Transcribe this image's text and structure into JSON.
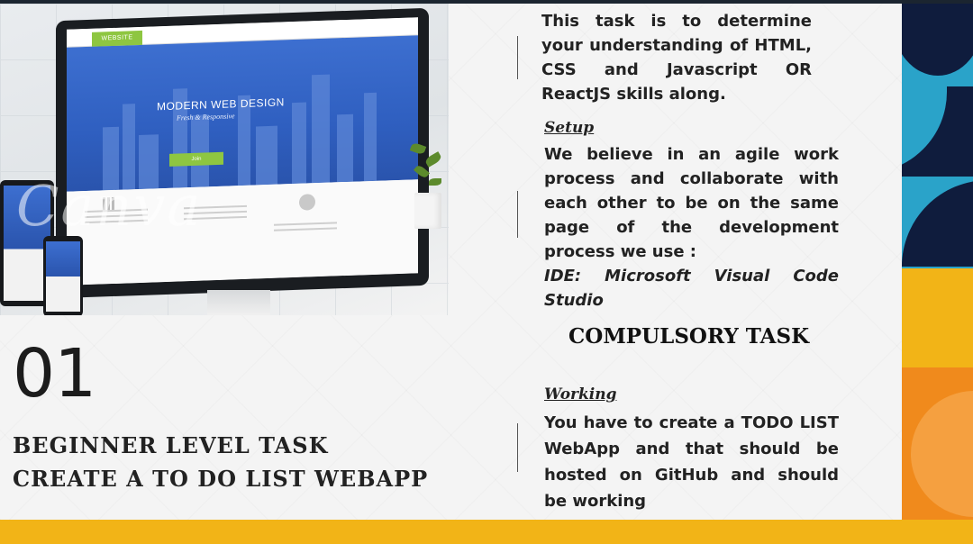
{
  "hero": {
    "nav_label": "WEBSITE",
    "banner_title": "MODERN WEB DESIGN",
    "banner_subtitle": "Fresh & Responsive",
    "join_label": "Join",
    "watermark": "Canva"
  },
  "left": {
    "number": "01",
    "title_line_1": "BEGINNER LEVEL TASK",
    "title_line_2": "CREATE A TO DO LIST WEBAPP"
  },
  "intro": {
    "text": "This task is to determine your understanding  of HTML, CSS and Javascript OR ReactJS skills along."
  },
  "setup": {
    "heading": "Setup",
    "text": "We believe in an agile work process and collaborate with each other to be on the same page of the development process we use :",
    "ide": "IDE: Microsoft Visual Code Studio"
  },
  "compulsory": {
    "heading": "COMPULSORY TASK"
  },
  "working": {
    "heading": "Working",
    "text": "You have to create a TODO LIST WebApp and that should be hosted on GitHub and should be working"
  },
  "colors": {
    "accent_yellow": "#f2b417",
    "pattern_navy": "#0f1c3d",
    "pattern_teal": "#2aa3c9",
    "pattern_orange": "#f08a1c"
  }
}
